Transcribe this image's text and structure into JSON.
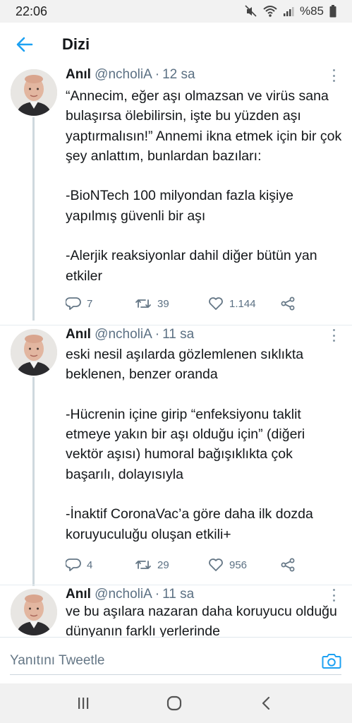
{
  "status_bar": {
    "time": "22:06",
    "battery": "%85",
    "icons": [
      "mute-icon",
      "wifi-icon",
      "signal-icon",
      "battery-icon"
    ]
  },
  "header": {
    "title": "Dizi",
    "back_icon": "back-arrow-icon"
  },
  "tweets": [
    {
      "name": "Anıl",
      "handle": "@ncholiA",
      "separator": "·",
      "time": "12 sa",
      "text": "“Annecim, eğer aşı olmazsan ve virüs sana bulaşırsa ölebilirsin, işte bu yüzden aşı yaptırmalısın!” Annemi ikna etmek için bir çok şey anlattım, bunlardan bazıları:\n\n-BioNTech 100 milyondan fazla kişiye yapılmış güvenli bir aşı\n\n-Alerjik reaksiyonlar dahil diğer bütün yan etkiler",
      "replies": "7",
      "retweets": "39",
      "likes": "1.144"
    },
    {
      "name": "Anıl",
      "handle": "@ncholiA",
      "separator": "·",
      "time": "11 sa",
      "text": "eski nesil aşılarda gözlemlenen sıklıkta beklenen, benzer oranda\n\n-Hücrenin içine girip “enfeksiyonu taklit etmeye yakın bir aşı olduğu için” (diğeri vektör aşısı) humoral bağışıklıkta çok başarılı, dolayısıyla\n\n-İnaktif CoronaVac’a göre daha ilk dozda koruyuculuğu oluşan etkili+",
      "replies": "4",
      "retweets": "29",
      "likes": "956"
    },
    {
      "name": "Anıl",
      "handle": "@ncholiA",
      "separator": "·",
      "time": "11 sa",
      "text": "ve bu aşılara nazaran daha koruyucu olduğu dünyanın farklı yerlerinde"
    }
  ],
  "reply_bar": {
    "placeholder": "Yanıtını Tweetle",
    "camera_icon": "camera-icon"
  },
  "nav_bar": {
    "icons": [
      "recent-apps-icon",
      "home-icon",
      "back-icon"
    ]
  },
  "colors": {
    "accent": "#1da1f2",
    "secondary_text": "#5b7083",
    "thread_line": "#cfd9de"
  }
}
